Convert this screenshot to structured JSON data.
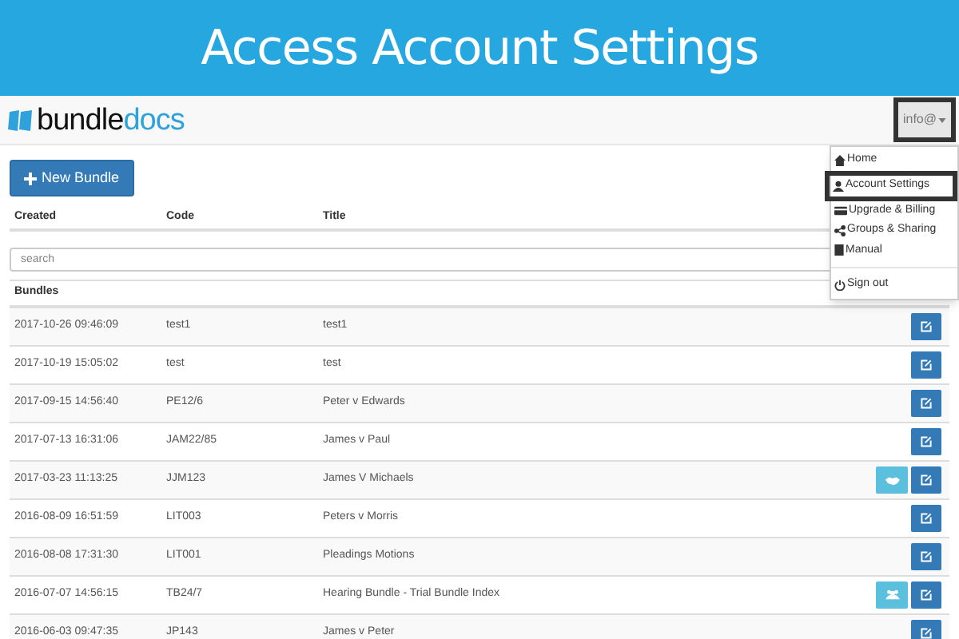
{
  "banner": {
    "title": "Access Account Settings"
  },
  "navbar": {
    "logo_text_dark": "bundle",
    "logo_text_light": "docs",
    "user_button": {
      "label": "info@",
      "highlighted": true
    }
  },
  "dropdown_menu": {
    "items": [
      {
        "kind": "item",
        "label": "Home",
        "highlighted": false
      },
      {
        "kind": "item",
        "label": "Account Settings",
        "highlighted": true
      },
      {
        "kind": "item",
        "label": "Upgrade & Billing",
        "highlighted": false
      },
      {
        "kind": "item",
        "label": "Groups & Sharing",
        "highlighted": false
      },
      {
        "kind": "item",
        "label": "Manual",
        "highlighted": false
      },
      {
        "kind": "divider"
      },
      {
        "kind": "item",
        "label": "Sign out",
        "highlighted": false
      }
    ]
  },
  "new_bundle_button": {
    "label": "New Bundle"
  },
  "table": {
    "columns": [
      "Created",
      "Code",
      "Title"
    ],
    "search": {
      "placeholder": "search"
    },
    "section_label": "Bundles",
    "rows": [
      {
        "kind": "plain",
        "created": "2017-10-26 09:46:09",
        "code": "test1",
        "title": "test1"
      },
      {
        "kind": "plain",
        "created": "2017-10-19 15:05:02",
        "code": "test",
        "title": "test"
      },
      {
        "kind": "plain",
        "created": "2017-09-15 14:56:40",
        "code": "PE12/6",
        "title": "Peter v Edwards"
      },
      {
        "kind": "plain",
        "created": "2017-07-13 16:31:06",
        "code": "JAM22/85",
        "title": "James v Paul"
      },
      {
        "kind": "shared",
        "created": "2017-03-23 11:13:25",
        "code": "JJM123",
        "title": "James V Michaels"
      },
      {
        "kind": "plain",
        "created": "2016-08-09 16:51:59",
        "code": "LIT003",
        "title": "Peters v Morris"
      },
      {
        "kind": "plain",
        "created": "2016-08-08 17:31:30",
        "code": "LIT001",
        "title": "Pleadings Motions"
      },
      {
        "kind": "group",
        "created": "2016-07-07 14:56:15",
        "code": "TB24/7",
        "title": "Hearing Bundle - Trial Bundle Index"
      },
      {
        "kind": "plain",
        "created": "2016-06-03 09:47:35",
        "code": "JP143",
        "title": "James v Peter"
      }
    ]
  }
}
